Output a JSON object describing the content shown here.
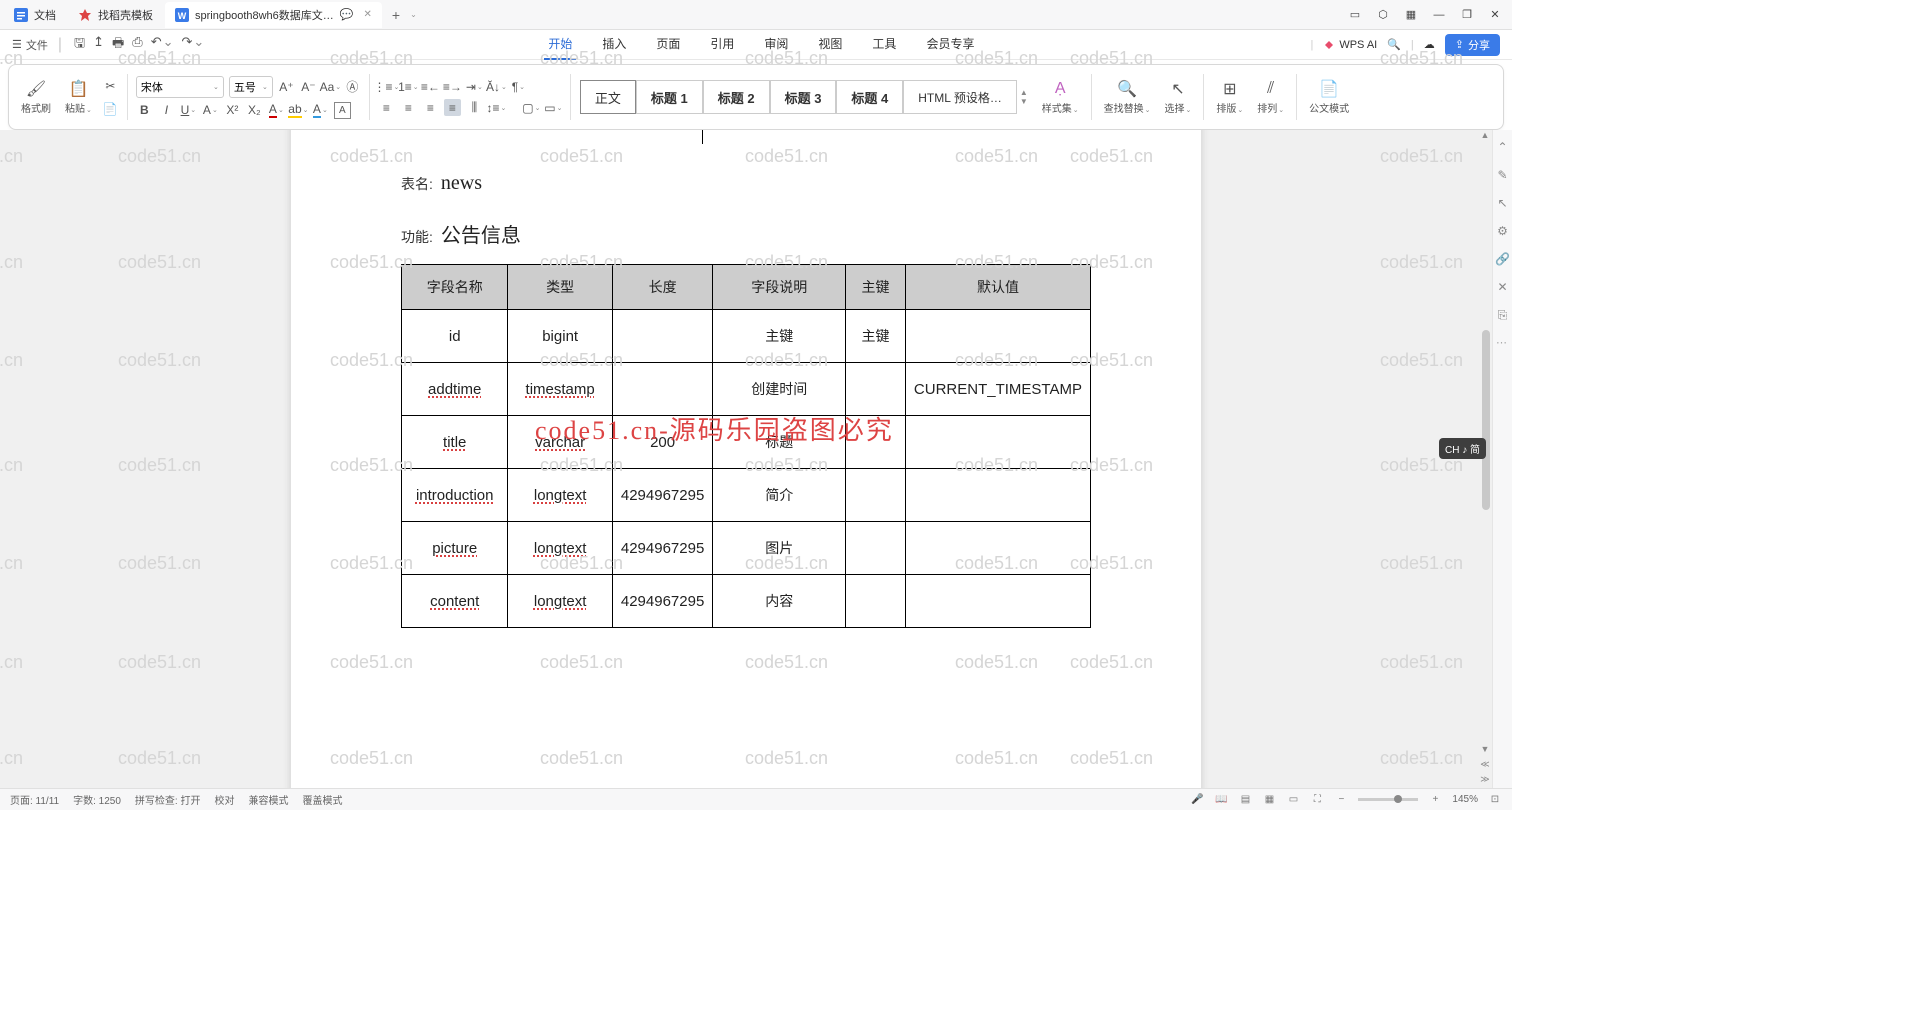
{
  "tabs": [
    {
      "icon_color": "#3a7be8",
      "label": "文档"
    },
    {
      "icon_color": "#d44",
      "label": "找稻壳模板"
    },
    {
      "icon_color": "#3a7be8",
      "label": "springbooth8wh6数据库文…"
    }
  ],
  "menu": {
    "file": "文件",
    "items": [
      "开始",
      "插入",
      "页面",
      "引用",
      "审阅",
      "视图",
      "工具",
      "会员专享"
    ],
    "wps_ai": "WPS AI",
    "share": "分享"
  },
  "ribbon": {
    "format_painter": "格式刷",
    "paste": "粘贴",
    "font_name": "宋体",
    "font_size": "五号",
    "styles": [
      "正文",
      "标题 1",
      "标题 2",
      "标题 3",
      "标题 4",
      "HTML 预设格…"
    ],
    "style_set": "样式集",
    "find_replace": "查找替换",
    "select": "选择",
    "sort": "排版",
    "arrange": "排列",
    "official_mode": "公文模式"
  },
  "document": {
    "table_name_label": "表名:",
    "table_name": "news",
    "function_label": "功能:",
    "function": "公告信息",
    "headers": [
      "字段名称",
      "类型",
      "长度",
      "字段说明",
      "主键",
      "默认值"
    ],
    "rows": [
      {
        "name": "id",
        "type": "bigint",
        "len": "",
        "desc": "主键",
        "pk": "主键",
        "default": ""
      },
      {
        "name": "addtime",
        "type": "timestamp",
        "len": "",
        "desc": "创建时间",
        "pk": "",
        "default": "CURRENT_TIMESTAMP"
      },
      {
        "name": "title",
        "type": "varchar",
        "len": "200",
        "desc": "标题",
        "pk": "",
        "default": ""
      },
      {
        "name": "introduction",
        "type": "longtext",
        "len": "4294967295",
        "desc": "简介",
        "pk": "",
        "default": ""
      },
      {
        "name": "picture",
        "type": "longtext",
        "len": "4294967295",
        "desc": "图片",
        "pk": "",
        "default": ""
      },
      {
        "name": "content",
        "type": "longtext",
        "len": "4294967295",
        "desc": "内容",
        "pk": "",
        "default": ""
      }
    ]
  },
  "watermark_text": "code51.cn",
  "watermark_red": "code51.cn-源码乐园盗图必究",
  "ime": "CH ♪ 简",
  "status": {
    "page": "页面: 11/11",
    "words": "字数: 1250",
    "spell": "拼写检查: 打开",
    "proof": "校对",
    "compat": "兼容模式",
    "mode": "覆盖模式",
    "zoom": "145%"
  }
}
